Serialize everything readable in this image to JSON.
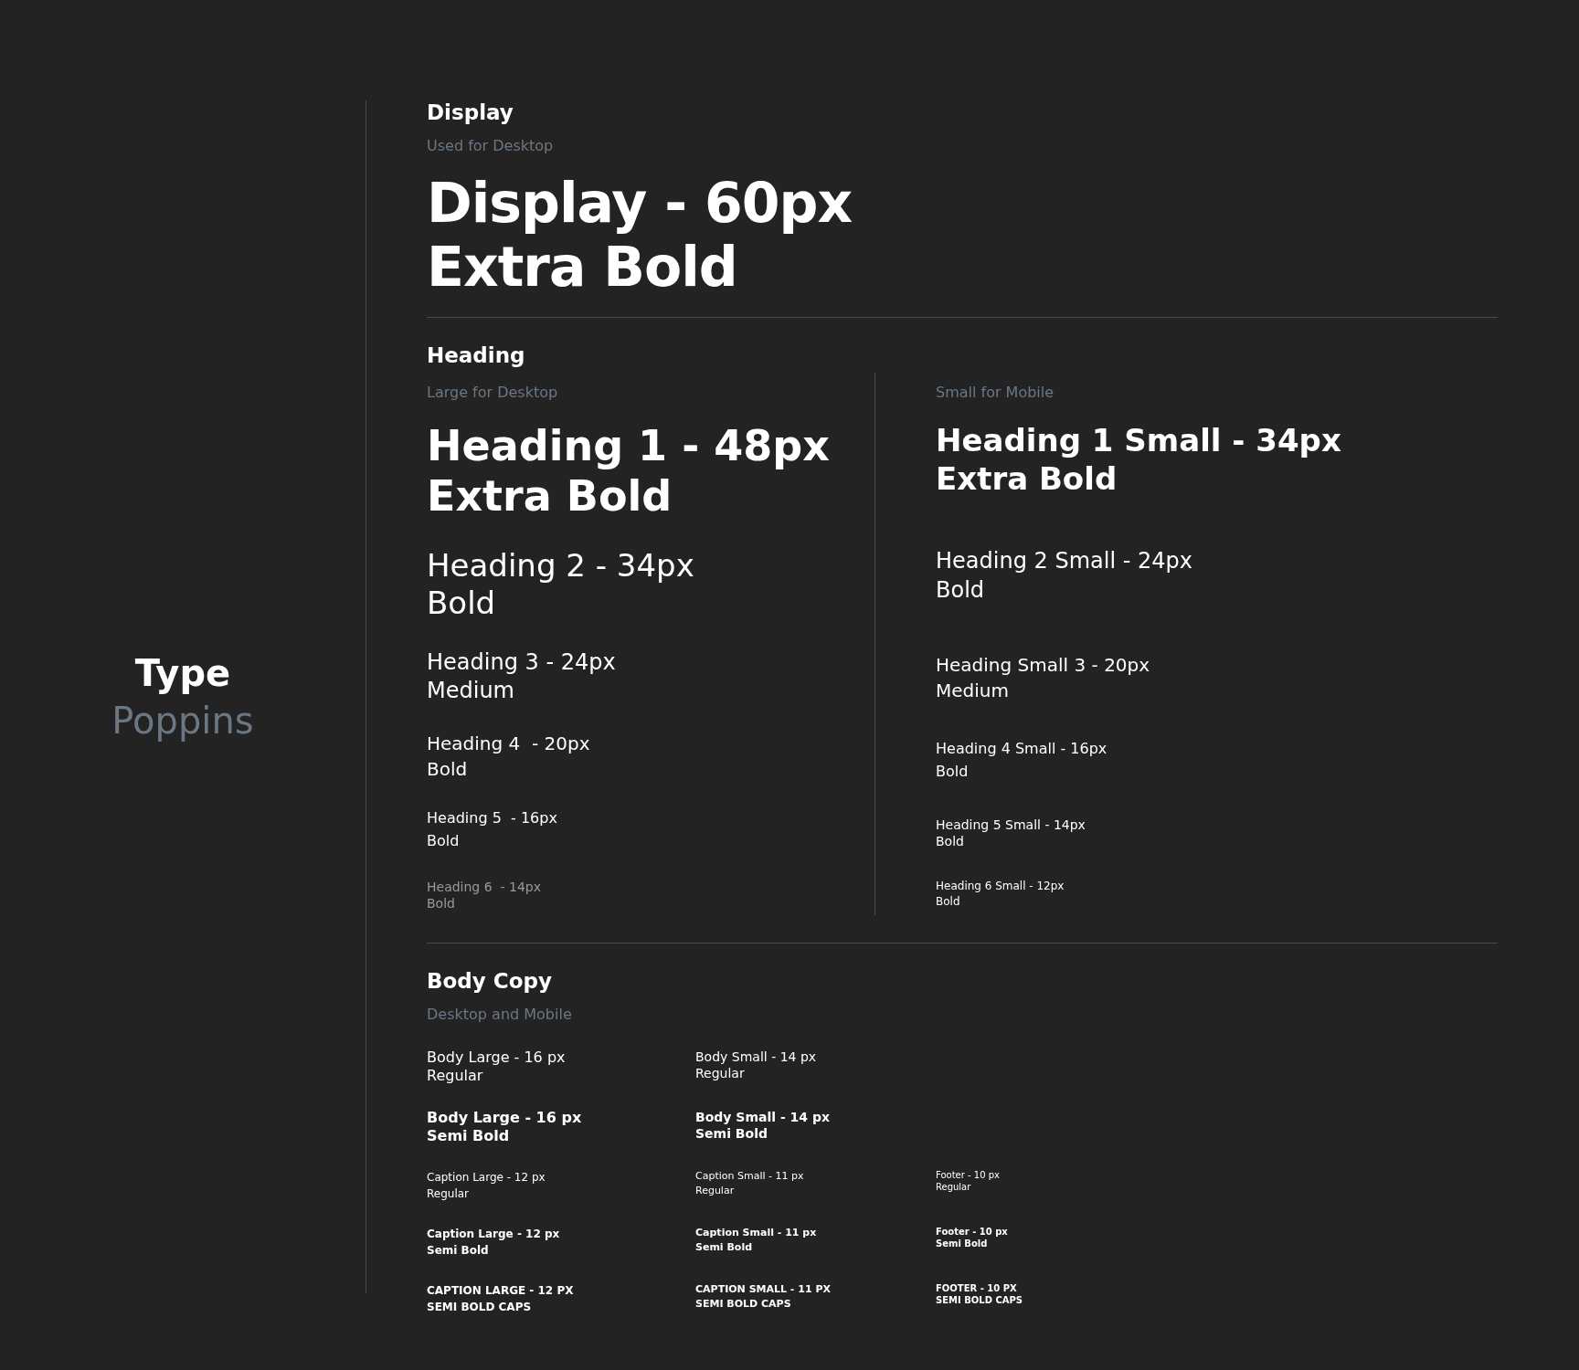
{
  "type_panel": {
    "title": "Type",
    "font_name": "Poppins"
  },
  "display": {
    "title": "Display",
    "subtitle": "Used for Desktop",
    "samples": [
      {
        "kind": "display",
        "lines": [
          "Display - 60px",
          "Extra Bold"
        ]
      }
    ]
  },
  "heading": {
    "title": "Heading",
    "large": {
      "subtitle": "Large for Desktop",
      "samples": [
        {
          "kind": "h1",
          "muted": false,
          "lines": [
            "Heading 1 - 48px",
            "Extra Bold"
          ]
        },
        {
          "kind": "h2",
          "muted": false,
          "lines": [
            "Heading 2 - 34px",
            "Bold"
          ]
        },
        {
          "kind": "h3",
          "muted": false,
          "lines": [
            "Heading 3 - 24px",
            "Medium"
          ]
        },
        {
          "kind": "h4",
          "muted": false,
          "lines": [
            "Heading 4  - 20px",
            "Bold"
          ]
        },
        {
          "kind": "h5",
          "muted": false,
          "lines": [
            "Heading 5  - 16px",
            "Bold"
          ]
        },
        {
          "kind": "h6",
          "muted": true,
          "lines": [
            "Heading 6  - 14px",
            "Bold"
          ]
        }
      ]
    },
    "small": {
      "subtitle": "Small for Mobile",
      "samples": [
        {
          "kind": "h1s",
          "muted": false,
          "lines": [
            "Heading 1 Small - 34px",
            "Extra Bold"
          ]
        },
        {
          "kind": "h2s",
          "muted": false,
          "lines": [
            "Heading 2 Small - 24px",
            "Bold"
          ]
        },
        {
          "kind": "h3s",
          "muted": false,
          "lines": [
            "Heading Small 3 - 20px",
            "Medium"
          ]
        },
        {
          "kind": "h4s",
          "muted": false,
          "lines": [
            "Heading 4 Small - 16px",
            "Bold"
          ]
        },
        {
          "kind": "h5s",
          "muted": false,
          "lines": [
            "Heading 5 Small - 14px",
            "Bold"
          ]
        },
        {
          "kind": "h6s",
          "muted": false,
          "lines": [
            "Heading 6 Small - 12px",
            "Bold"
          ]
        }
      ]
    }
  },
  "body_copy": {
    "title": "Body Copy",
    "subtitle": "Desktop and Mobile",
    "rows": [
      [
        {
          "kind": "body-l",
          "lines": [
            "Body Large - 16 px",
            "Regular"
          ]
        },
        {
          "kind": "body-s",
          "lines": [
            "Body Small - 14 px",
            "Regular"
          ]
        }
      ],
      [
        {
          "kind": "body-l-b",
          "lines": [
            "Body Large - 16 px",
            "Semi Bold"
          ]
        },
        {
          "kind": "body-s-b",
          "lines": [
            "Body Small - 14 px",
            "Semi Bold"
          ]
        }
      ],
      [
        {
          "kind": "cap-l",
          "lines": [
            "Caption Large - 12 px",
            "Regular"
          ]
        },
        {
          "kind": "cap-s",
          "lines": [
            "Caption Small - 11 px",
            "Regular"
          ]
        },
        {
          "kind": "foot",
          "lines": [
            "Footer - 10 px",
            "Regular"
          ]
        }
      ],
      [
        {
          "kind": "cap-l-b",
          "lines": [
            "Caption Large - 12 px",
            "Semi Bold"
          ]
        },
        {
          "kind": "cap-s-b",
          "lines": [
            "Caption Small - 11 px",
            "Semi Bold"
          ]
        },
        {
          "kind": "foot-b",
          "lines": [
            "Footer - 10 px",
            "Semi Bold"
          ]
        }
      ],
      [
        {
          "kind": "cap-l-b",
          "lines": [
            "CAPTION LARGE - 12 PX",
            "SEMI BOLD CAPS"
          ]
        },
        {
          "kind": "cap-s-b",
          "lines": [
            "CAPTION SMALL - 11 PX",
            "SEMI BOLD CAPS"
          ]
        },
        {
          "kind": "foot-b",
          "lines": [
            "FOOTER - 10 PX",
            "SEMI BOLD CAPS"
          ]
        }
      ]
    ]
  }
}
